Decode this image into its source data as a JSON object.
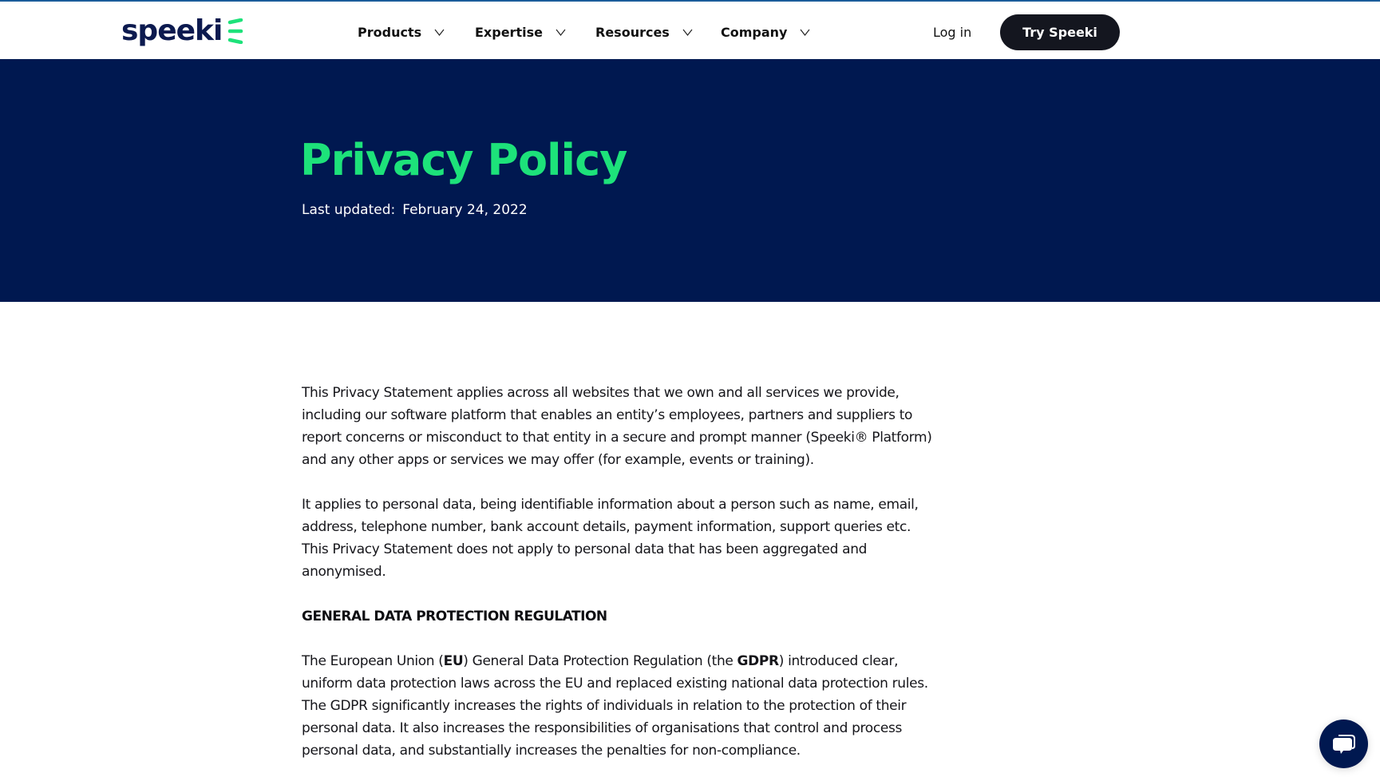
{
  "header": {
    "logo_text": "speeki",
    "nav": [
      {
        "label": "Products"
      },
      {
        "label": "Expertise"
      },
      {
        "label": "Resources"
      },
      {
        "label": "Company"
      }
    ],
    "login_label": "Log in",
    "cta_label": "Try Speeki"
  },
  "hero": {
    "title": "Privacy Policy",
    "updated_label": "Last updated:",
    "updated_date": "February 24, 2022"
  },
  "content": {
    "p1": "This Privacy Statement applies across all websites that we own and all services we provide, including our software platform that enables an entity’s employees, partners and suppliers to report concerns or misconduct to that entity in a secure and prompt manner (Speeki® Platform) and any other apps or services we may offer (for example, events or training).",
    "p2": "It applies to personal data, being identifiable information about a person such as name, email, address, telephone number, bank account details, payment information, support queries etc.  This Privacy Statement does not apply to personal data that has been aggregated and anonymised.",
    "heading": "GENERAL DATA PROTECTION REGULATION",
    "p3": {
      "part1": "The European Union (",
      "bold1": "EU",
      "part2": ") General Data Protection Regulation (the ",
      "bold2": "GDPR",
      "part3": ") introduced clear, uniform data protection laws across the EU and replaced existing national data protection rules. The GDPR significantly increases the rights of individuals in relation to the protection of their personal data. It also increases the responsibilities of organisations that control and process personal data, and substantially increases the penalties for non-compliance."
    }
  },
  "colors": {
    "navy": "#001850",
    "brand_green": "#1de27a",
    "cta_bg": "#14161f"
  },
  "chat": {
    "icon": "chat-bubbles-icon"
  }
}
